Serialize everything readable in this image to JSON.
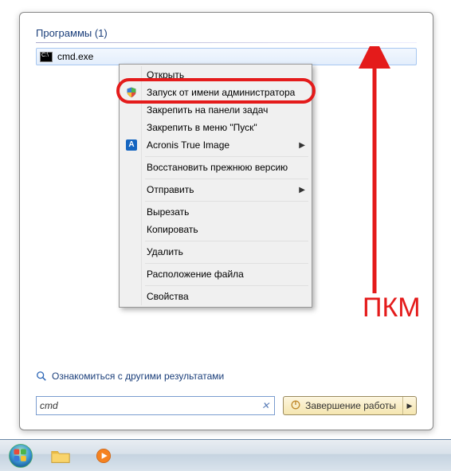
{
  "section_header": "Программы (1)",
  "result": {
    "label": "cmd.exe"
  },
  "context_menu": {
    "open": "Открыть",
    "run_as_admin": "Запуск от имени администратора",
    "pin_taskbar": "Закрепить на панели задач",
    "pin_start": "Закрепить в меню \"Пуск\"",
    "acronis": "Acronis True Image",
    "restore_prev": "Восстановить прежнюю версию",
    "send_to": "Отправить",
    "cut": "Вырезать",
    "copy": "Копировать",
    "delete": "Удалить",
    "open_location": "Расположение файла",
    "properties": "Свойства"
  },
  "see_more": "Ознакомиться с другими результатами",
  "search_value": "cmd",
  "shutdown_label": "Завершение работы",
  "annotation_label": "ПКМ",
  "acronis_letter": "A"
}
